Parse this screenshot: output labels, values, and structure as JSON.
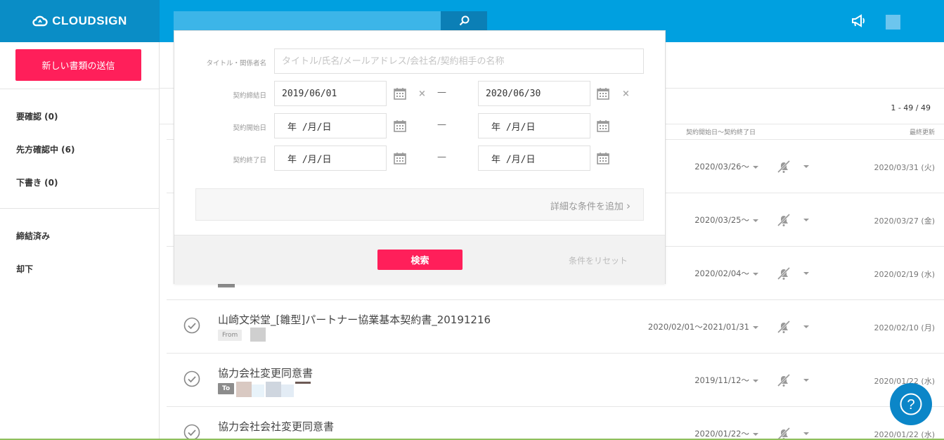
{
  "header": {
    "brand": "CLOUDSIGN",
    "search_value": ""
  },
  "sidebar": {
    "new_doc_button": "新しい書類の送信",
    "items": [
      "要確認 (0)",
      "先方確認中 (6)",
      "下書き (0)",
      "締結済み",
      "却下"
    ]
  },
  "list": {
    "count": "1 - 49 / 49",
    "col_date": "契約開始日〜契約終了日",
    "col_updated": "最終更新",
    "rows": [
      {
        "title": "",
        "tag": "",
        "date": "2020/03/26〜",
        "updated": "2020/03/31 (火)"
      },
      {
        "title": "",
        "tag": "",
        "date": "2020/03/25〜",
        "updated": "2020/03/27 (金)"
      },
      {
        "title": "",
        "tag": "",
        "date": "2020/02/04〜",
        "updated": "2020/02/19 (水)"
      },
      {
        "title": "山崎文栄堂_[雛型]パートナー協業基本契約書_20191216",
        "tag": "From",
        "date": "2020/02/01〜2021/01/31",
        "updated": "2020/02/10 (月)"
      },
      {
        "title": "協力会社変更同意書",
        "tag": "To",
        "date": "2019/11/12〜",
        "updated": "2020/01/22 (水)"
      },
      {
        "title": "協力会社会社変更同意書",
        "tag": "",
        "date": "2020/01/22〜",
        "updated": "2020/01/22 (水)"
      }
    ]
  },
  "search_panel": {
    "label_title": "タイトル・関係者名",
    "title_placeholder": "タイトル/氏名/メールアドレス/会社名/契約相手の名称",
    "label_signed": "契約締結日",
    "signed_from": "2019/06/01",
    "signed_to": "2020/06/30",
    "label_start": "契約開始日",
    "start_from": "年 /月/日",
    "start_to": "年 /月/日",
    "label_end": "契約終了日",
    "end_from": "年 /月/日",
    "end_to": "年 /月/日",
    "clear_mark": "×",
    "range_dash": "—",
    "more_conditions": "詳細な条件を追加",
    "more_chevron": "›",
    "search_button": "検索",
    "reset_link": "条件をリセット"
  },
  "help": {
    "label": "?"
  },
  "colors": {
    "header_bg": "#00a0e0",
    "brand_bg": "#0a8dc6",
    "accent": "#ff1f5a",
    "help_bg": "#0b86c8"
  }
}
